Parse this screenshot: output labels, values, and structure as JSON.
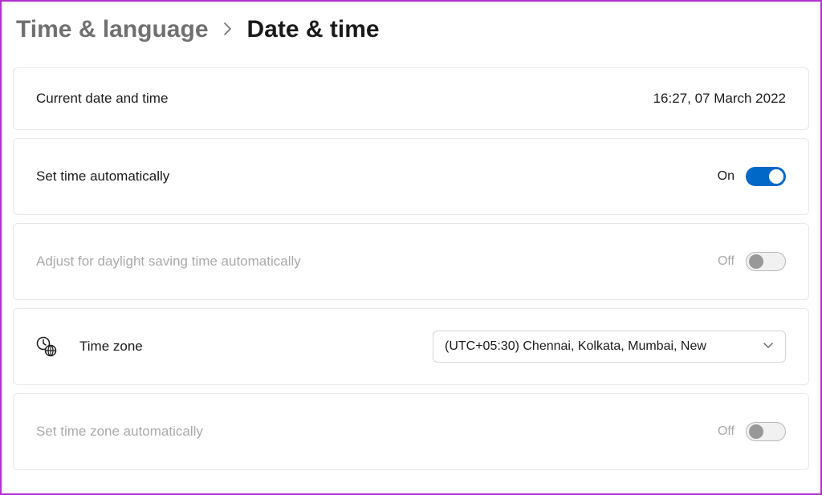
{
  "breadcrumb": {
    "parent": "Time & language",
    "current": "Date & time"
  },
  "rows": {
    "current": {
      "label": "Current date and time",
      "value": "16:27, 07 March 2022"
    },
    "auto_time": {
      "label": "Set time automatically",
      "state_text": "On",
      "on": true,
      "enabled": true
    },
    "dst": {
      "label": "Adjust for daylight saving time automatically",
      "state_text": "Off",
      "on": false,
      "enabled": false
    },
    "timezone": {
      "label": "Time zone",
      "selected": "(UTC+05:30) Chennai, Kolkata, Mumbai, New"
    },
    "auto_tz": {
      "label": "Set time zone automatically",
      "state_text": "Off",
      "on": false,
      "enabled": false
    }
  }
}
